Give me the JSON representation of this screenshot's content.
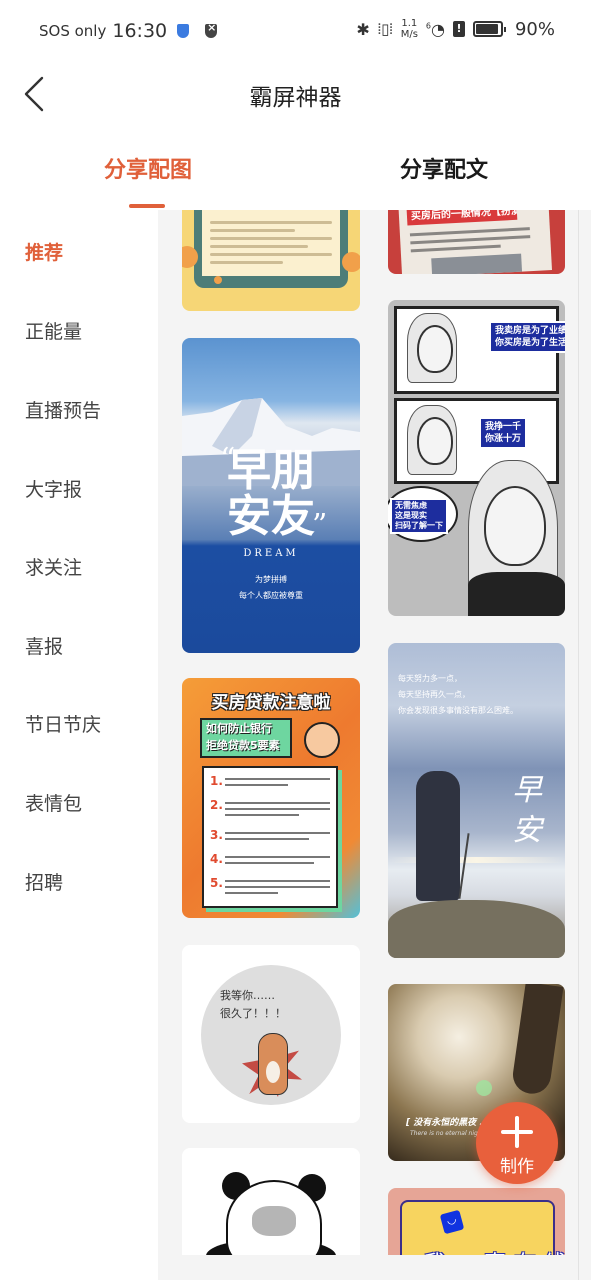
{
  "status_bar": {
    "carrier": "SOS only",
    "time": "16:30",
    "network_speed_value": "1.1",
    "network_speed_unit": "M/s",
    "wifi_label": "6",
    "battery_percent": "90%",
    "battery_level": 0.9
  },
  "header": {
    "title": "霸屏神器",
    "back_icon": "chevron-left-icon"
  },
  "tabs": [
    {
      "label": "分享配图",
      "active": true
    },
    {
      "label": "分享配文",
      "active": false
    }
  ],
  "colors": {
    "accent": "#e0603a",
    "fab": "#e8603c",
    "panel_background": "#f4f4f4"
  },
  "sidebar": {
    "items": [
      {
        "label": "推荐",
        "active": true
      },
      {
        "label": "正能量",
        "active": false
      },
      {
        "label": "直播预告",
        "active": false
      },
      {
        "label": "大字报",
        "active": false
      },
      {
        "label": "求关注",
        "active": false
      },
      {
        "label": "喜报",
        "active": false
      },
      {
        "label": "节日节庆",
        "active": false
      },
      {
        "label": "表情包",
        "active": false
      },
      {
        "label": "招聘",
        "active": false
      }
    ]
  },
  "cards": {
    "newspaper": {
      "banner": "买房后的一般情况【扮演】"
    },
    "mountain": {
      "headline_1": "早朋",
      "headline_2": "安友",
      "open_quote": "“",
      "close_quote": "”",
      "english": "DREAM",
      "subtitle_1": "为梦拼搏",
      "subtitle_2": "每个人都应被尊重"
    },
    "comic": {
      "bubble_1": "我卖房是为了业绩\n你买房是为了生活",
      "bubble_2": "我挣一千\n你涨十万",
      "bubble_3": "无需焦虑\n这是现实\n扫码了解一下"
    },
    "loan": {
      "title": "买房贷款注意啦",
      "subtitle_1": "如何防止银行",
      "subtitle_2": "拒绝贷款5要素",
      "numbers": [
        "1.",
        "2.",
        "3.",
        "4.",
        "5."
      ]
    },
    "hiker": {
      "line_1": "每天努力多一点，",
      "line_2": "每天坚持再久一点，",
      "line_3": "你会发现很多事情没有那么困难。",
      "headline_1": "早",
      "headline_2": "安"
    },
    "dog": {
      "line_1": "我等你……",
      "line_2": "很久了！！！"
    },
    "field": {
      "chinese": "[ 没有永恒的黑夜 .",
      "english": "There is no eternal night"
    },
    "online": {
      "text": "我一直在线",
      "bag_icon": "shopping-bag-icon"
    }
  },
  "fab": {
    "label": "制作",
    "icon": "plus-icon"
  }
}
